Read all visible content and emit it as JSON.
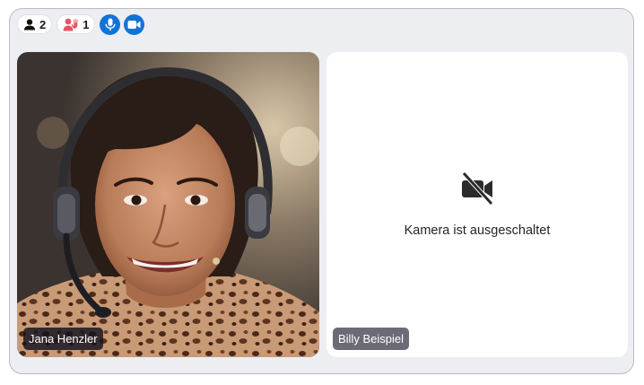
{
  "toolbar": {
    "participants_count": "2",
    "hand_count": "1",
    "icons": {
      "participants": "person-icon",
      "hand": "hand-raised-icon",
      "mic": "microphone-icon",
      "camera": "video-camera-icon"
    },
    "accent_color": "#1273d6",
    "hand_color": "#e5545e"
  },
  "tiles": [
    {
      "name": "Jana Henzler",
      "camera_on": true
    },
    {
      "name": "Billy Beispiel",
      "camera_on": false,
      "status_text": "Kamera ist ausgeschaltet",
      "status_icon": "video-off-icon"
    }
  ]
}
